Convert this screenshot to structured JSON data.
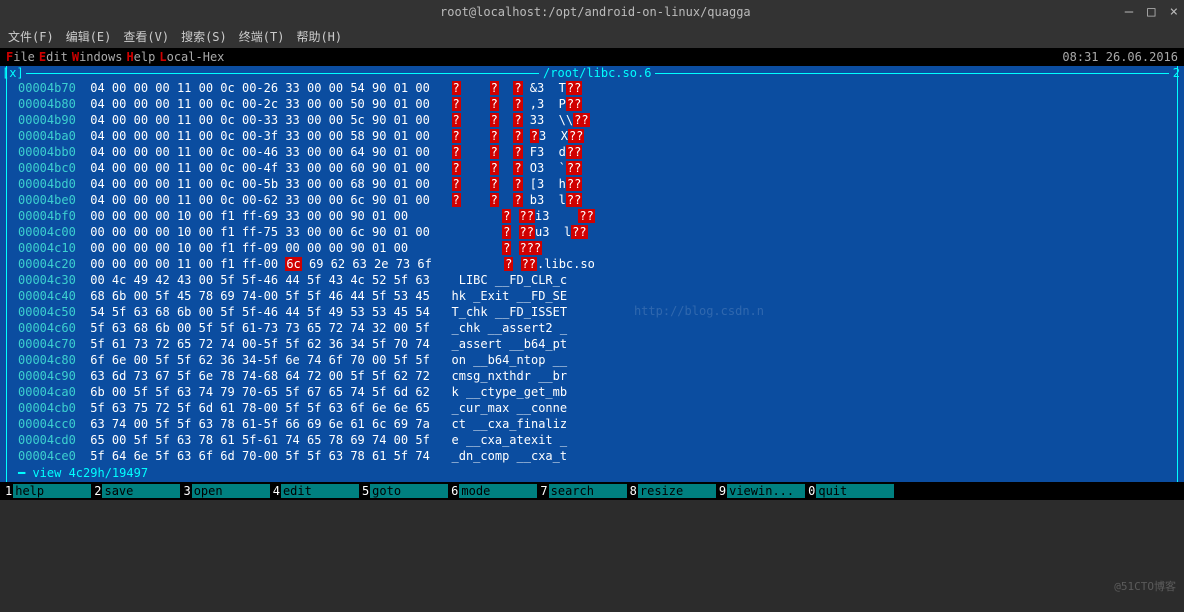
{
  "window": {
    "title": "root@localhost:/opt/android-on-linux/quagga",
    "min": "—",
    "max": "□",
    "close": "×"
  },
  "sysmenu": {
    "file": "文件(F)",
    "edit": "编辑(E)",
    "view": "查看(V)",
    "search": "搜索(S)",
    "terminal": "终端(T)",
    "help": "帮助(H)"
  },
  "appmenu": {
    "file": "File",
    "edit": "Edit",
    "windows": "Windows",
    "help": "Help",
    "local": "Local-Hex",
    "time": "08:31 26.06.2016"
  },
  "border": {
    "x": "[x]",
    "file": " /root/libc.so.6 ",
    "two": "2"
  },
  "rows": [
    {
      "a": "00004b70",
      "h": "04 00 00 00 11 00 0c 00-26 33 00 00 54 90 01 00",
      "d": "?    ?  ? &3  T??"
    },
    {
      "a": "00004b80",
      "h": "04 00 00 00 11 00 0c 00-2c 33 00 00 50 90 01 00",
      "d": "?    ?  ? ,3  P??"
    },
    {
      "a": "00004b90",
      "h": "04 00 00 00 11 00 0c 00-33 33 00 00 5c 90 01 00",
      "d": "?    ?  ? 33  \\\\??"
    },
    {
      "a": "00004ba0",
      "h": "04 00 00 00 11 00 0c 00-3f 33 00 00 58 90 01 00",
      "d": "?    ?  ? ?3  X??"
    },
    {
      "a": "00004bb0",
      "h": "04 00 00 00 11 00 0c 00-46 33 00 00 64 90 01 00",
      "d": "?    ?  ? F3  d??"
    },
    {
      "a": "00004bc0",
      "h": "04 00 00 00 11 00 0c 00-4f 33 00 00 60 90 01 00",
      "d": "?    ?  ? O3  `??"
    },
    {
      "a": "00004bd0",
      "h": "04 00 00 00 11 00 0c 00-5b 33 00 00 68 90 01 00",
      "d": "?    ?  ? [3  h??"
    },
    {
      "a": "00004be0",
      "h": "04 00 00 00 11 00 0c 00-62 33 00 00 6c 90 01 00",
      "d": "?    ?  ? b3  l??"
    },
    {
      "a": "00004bf0",
      "h": "00 00 00 00 10 00 f1 ff-69 33 00 00 90 01 00   ",
      "d": "       ? ??i3    ??"
    },
    {
      "a": "00004c00",
      "h": "00 00 00 00 10 00 f1 ff-75 33 00 00 6c 90 01 00",
      "d": "       ? ??u3  l??"
    },
    {
      "a": "00004c10",
      "h": "00 00 00 00 10 00 f1 ff-09 00 00 00 90 01 00   ",
      "d": "       ? ???      "
    },
    {
      "a": "00004c20",
      "h": "00 00 00 00 11 00 f1 ff-00 ",
      "sel": "6c",
      "h2": " 69 62 63 2e 73 6f",
      "d": "       ? ??.libc.so"
    },
    {
      "a": "00004c30",
      "h": "00 4c 49 42 43 00 5f 5f-46 44 5f 43 4c 52 5f 63",
      "d": " LIBC __FD_CLR_c"
    },
    {
      "a": "00004c40",
      "h": "68 6b 00 5f 45 78 69 74-00 5f 5f 46 44 5f 53 45",
      "d": "hk _Exit __FD_SE"
    },
    {
      "a": "00004c50",
      "h": "54 5f 63 68 6b 00 5f 5f-46 44 5f 49 53 53 45 54",
      "d": "T_chk __FD_ISSET"
    },
    {
      "a": "00004c60",
      "h": "5f 63 68 6b 00 5f 5f 61-73 73 65 72 74 32 00 5f",
      "d": "_chk __assert2 _"
    },
    {
      "a": "00004c70",
      "h": "5f 61 73 72 65 72 74 00-5f 5f 62 36 34 5f 70 74",
      "d": "_assert __b64_pt"
    },
    {
      "a": "00004c80",
      "h": "6f 6e 00 5f 5f 62 36 34-5f 6e 74 6f 70 00 5f 5f",
      "d": "on __b64_ntop __"
    },
    {
      "a": "00004c90",
      "h": "63 6d 73 67 5f 6e 78 74-68 64 72 00 5f 5f 62 72",
      "d": "cmsg_nxthdr __br"
    },
    {
      "a": "00004ca0",
      "h": "6b 00 5f 5f 63 74 79 70-65 5f 67 65 74 5f 6d 62",
      "d": "k __ctype_get_mb"
    },
    {
      "a": "00004cb0",
      "h": "5f 63 75 72 5f 6d 61 78-00 5f 5f 63 6f 6e 6e 65",
      "d": "_cur_max __conne"
    },
    {
      "a": "00004cc0",
      "h": "63 74 00 5f 5f 63 78 61-5f 66 69 6e 61 6c 69 7a",
      "d": "ct __cxa_finaliz"
    },
    {
      "a": "00004cd0",
      "h": "65 00 5f 5f 63 78 61 5f-61 74 65 78 69 74 00 5f",
      "d": "e __cxa_atexit _"
    },
    {
      "a": "00004ce0",
      "h": "5f 64 6e 5f 63 6f 6d 70-00 5f 5f 63 78 61 5f 74",
      "d": "_dn_comp __cxa_t"
    }
  ],
  "status": "━ view 4c29h/19497 ",
  "watermark": "http://blog.csdn.n",
  "fkeys": [
    {
      "n": "1",
      "l": "help"
    },
    {
      "n": "2",
      "l": "save"
    },
    {
      "n": "3",
      "l": "open"
    },
    {
      "n": "4",
      "l": "edit"
    },
    {
      "n": "5",
      "l": "goto"
    },
    {
      "n": "6",
      "l": "mode"
    },
    {
      "n": "7",
      "l": "search"
    },
    {
      "n": "8",
      "l": "resize"
    },
    {
      "n": "9",
      "l": "viewin..."
    },
    {
      "n": "0",
      "l": "quit"
    }
  ],
  "cornermark": "@51CTO博客"
}
